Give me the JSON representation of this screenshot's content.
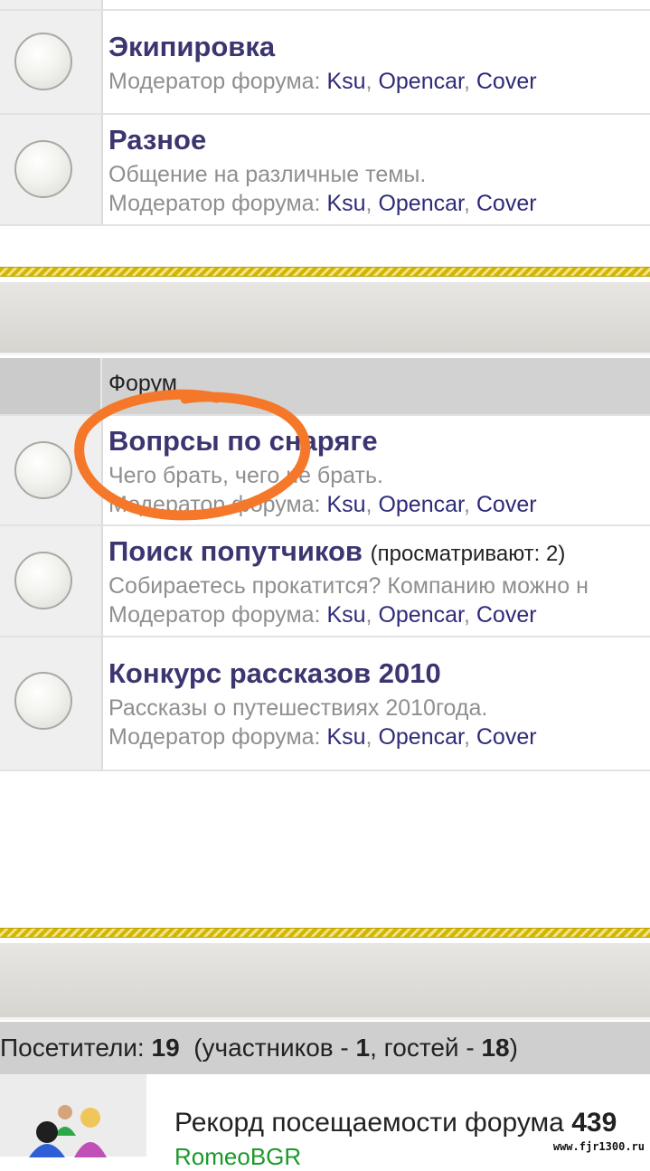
{
  "forums_top": [
    {
      "title": "Экипировка",
      "description": "",
      "moderator_label": "Модератор форума:",
      "moderators": [
        "Ksu",
        "Opencar",
        "Cover"
      ]
    },
    {
      "title": "Разное",
      "description": "Общение на различные темы.",
      "moderator_label": "Модератор форума:",
      "moderators": [
        "Ksu",
        "Opencar",
        "Cover"
      ]
    }
  ],
  "section_header": {
    "label": "Форум"
  },
  "forums_bottom": [
    {
      "title": "Вопрсы по снаряге",
      "suffix": "",
      "description": "Чего брать, чего не брать.",
      "moderator_label": "Модератор форума:",
      "moderators": [
        "Ksu",
        "Opencar",
        "Cover"
      ]
    },
    {
      "title": "Поиск попутчиков",
      "suffix": "(просматривают: 2)",
      "description": "Собираетесь прокатится? Компанию можно н",
      "moderator_label": "Модератор форума:",
      "moderators": [
        "Ksu",
        "Opencar",
        "Cover"
      ]
    },
    {
      "title": "Конкурс рассказов 2010",
      "suffix": "",
      "description": "Рассказы о путешествиях 2010года.",
      "moderator_label": "Модератор форума:",
      "moderators": [
        "Ksu",
        "Opencar",
        "Cover"
      ]
    }
  ],
  "visitors": {
    "label": "Посетители:",
    "total": "19",
    "open": "(участников -",
    "members": "1",
    "guests_label": ", гостей -",
    "guests": "18",
    "close": ")"
  },
  "stats": {
    "record_label": "Рекорд посещаемости форума",
    "record_value": "439",
    "last_user": "RomeoBGR"
  },
  "watermark": "www.fjr1300.ru",
  "colors": {
    "title": "#3b3570",
    "moderator_link": "#2e2b78",
    "annotation": "#f5782a",
    "stripe": "#d2b600"
  }
}
